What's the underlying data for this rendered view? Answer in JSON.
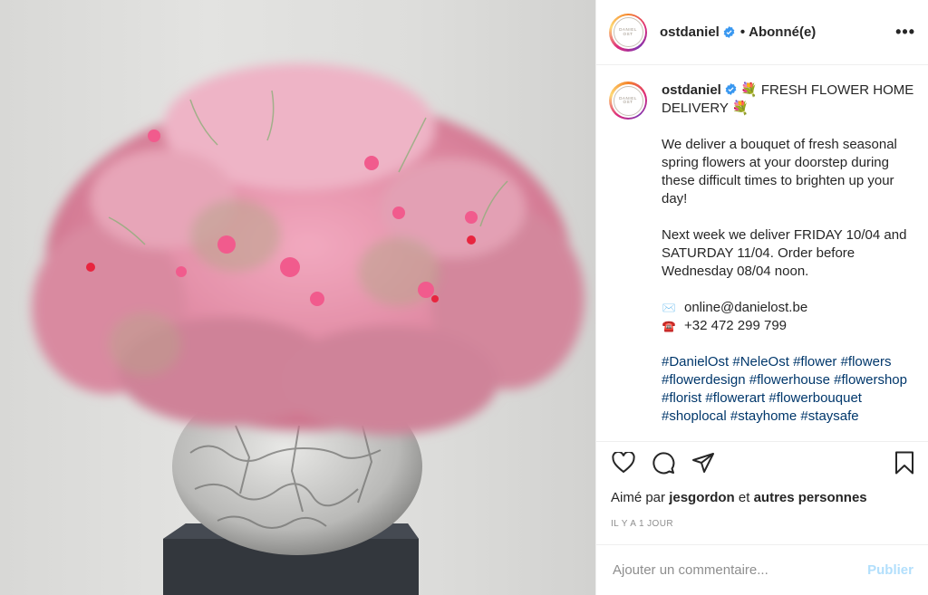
{
  "post": {
    "image_alt": "Arrangement of pink flowers in a marbled grey vase",
    "header": {
      "username": "ostdaniel",
      "separator": "•",
      "follow_status": "Abonné(e)",
      "more": "•••",
      "avatar_text": "DANIEL OST"
    },
    "caption": {
      "username": "ostdaniel",
      "title_emoji": "💐",
      "title": "FRESH FLOWER HOME DELIVERY",
      "title_emoji_end": "💐",
      "paragraph1": "We deliver a bouquet of fresh seasonal spring flowers at your doorstep during these difficult times to brighten up your day!",
      "paragraph2": "Next week we deliver FRIDAY 10/04 and SATURDAY 11/04. Order before Wednesday 08/04 noon.",
      "email_icon": "✉️",
      "email": "online@danielost.be",
      "phone_icon": "☎️",
      "phone": "+32 472 299 799",
      "hashtags": "#DanielOst #NeleOst #flower #flowers #flowerdesign #flowerhouse #flowershop #florist #flowerart #flowerbouquet #shoplocal #stayhome #staysafe"
    },
    "likes": {
      "prefix": "Aimé par",
      "user": "jesgordon",
      "connector": "et",
      "others": "autres personnes"
    },
    "timestamp": "IL Y A 1 JOUR",
    "comment": {
      "placeholder": "Ajouter un commentaire...",
      "publish_label": "Publier"
    },
    "colors": {
      "verified": "#3897f0",
      "hashtag": "#00376b",
      "publish_disabled": "#b2dffc",
      "secondary_text": "#8e8e8e"
    },
    "icons": [
      "heart-icon",
      "comment-icon",
      "share-icon",
      "bookmark-icon",
      "verified-icon",
      "more-icon"
    ]
  }
}
